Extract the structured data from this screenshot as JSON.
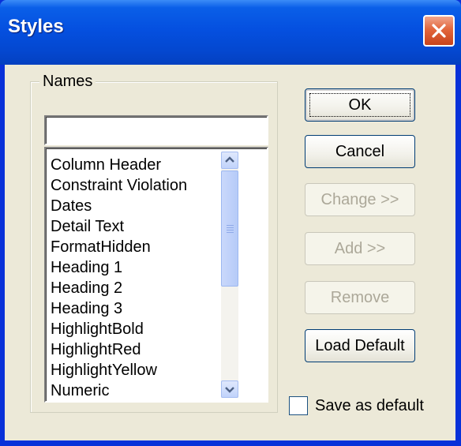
{
  "window": {
    "title": "Styles"
  },
  "names_group": {
    "label": "Names",
    "input_value": "",
    "items": [
      "Column Header",
      "Constraint Violation",
      "Dates",
      "Detail Text",
      "FormatHidden",
      "Heading 1",
      "Heading 2",
      "Heading 3",
      "HighlightBold",
      "HighlightRed",
      "HighlightYellow",
      "Numeric"
    ]
  },
  "buttons": {
    "ok": "OK",
    "cancel": "Cancel",
    "change": "Change >>",
    "add": "Add >>",
    "remove": "Remove",
    "load_default": "Load Default"
  },
  "save_as_default": {
    "label": "Save as default",
    "checked": false
  },
  "colors": {
    "titlebar": "#0550e0",
    "face": "#ece9d8",
    "close": "#e2663c",
    "disabled_text": "#aca899"
  }
}
